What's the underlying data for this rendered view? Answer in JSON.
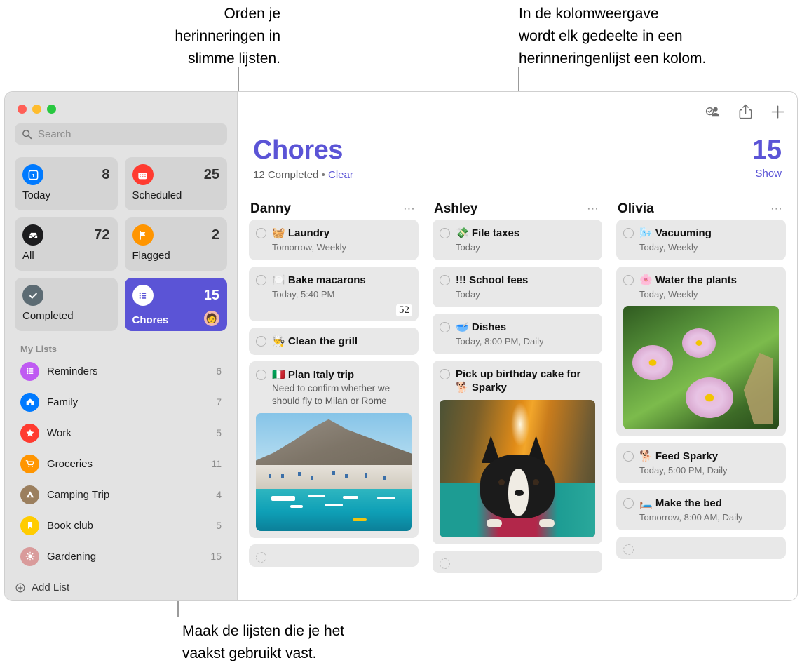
{
  "callouts": {
    "top_left": "Orden je\nherinneringen in\nslimme lijsten.",
    "top_right": "In de kolomweergave\nwordt elk gedeelte in een\nherinneringenlijst een kolom.",
    "bottom": "Maak de lijsten die je het\nvaakst gebruikt vast."
  },
  "colors": {
    "accent": "#5b54d6",
    "sidebar_bg": "#e3e3e3",
    "card_bg": "#e8e8e8"
  },
  "sidebar": {
    "search": {
      "placeholder": "Search"
    },
    "smart_lists": [
      {
        "label": "Today",
        "count": "8",
        "icon": "calendar-day-icon",
        "icon_bg": "#007aff",
        "active": false
      },
      {
        "label": "Scheduled",
        "count": "25",
        "icon": "calendar-icon",
        "icon_bg": "#ff3b30",
        "active": false
      },
      {
        "label": "All",
        "count": "72",
        "icon": "inbox-icon",
        "icon_bg": "#1c1c1e",
        "active": false
      },
      {
        "label": "Flagged",
        "count": "2",
        "icon": "flag-icon",
        "icon_bg": "#ff9500",
        "active": false
      },
      {
        "label": "Completed",
        "count": "",
        "icon": "checkmark-icon",
        "icon_bg": "#5c6b73",
        "active": false
      },
      {
        "label": "Chores",
        "count": "15",
        "icon": "list-bullet-icon",
        "icon_bg": "#ffffff",
        "active": true,
        "avatar": "avatar-icon"
      }
    ],
    "my_lists_header": "My Lists",
    "lists": [
      {
        "label": "Reminders",
        "count": "6",
        "icon": "list-bullet-icon",
        "icon_bg": "#bf5af2"
      },
      {
        "label": "Family",
        "count": "7",
        "icon": "house-icon",
        "icon_bg": "#007aff"
      },
      {
        "label": "Work",
        "count": "5",
        "icon": "star-icon",
        "icon_bg": "#ff3b30"
      },
      {
        "label": "Groceries",
        "count": "11",
        "icon": "cart-icon",
        "icon_bg": "#ff9500"
      },
      {
        "label": "Camping Trip",
        "count": "4",
        "icon": "tent-icon",
        "icon_bg": "#9b7f5e"
      },
      {
        "label": "Book club",
        "count": "5",
        "icon": "bookmark-icon",
        "icon_bg": "#ffcc00"
      },
      {
        "label": "Gardening",
        "count": "15",
        "icon": "sun-icon",
        "icon_bg": "#d99b9b"
      }
    ],
    "add_list_label": "Add List"
  },
  "main": {
    "toolbar": [
      {
        "name": "share-people-icon"
      },
      {
        "name": "share-icon"
      },
      {
        "name": "add-icon"
      }
    ],
    "title": "Chores",
    "completed_text": "12 Completed",
    "separator": "•",
    "clear_label": "Clear",
    "count": "15",
    "show_label": "Show",
    "columns": [
      {
        "title": "Danny",
        "more": "⋯",
        "items": [
          {
            "emoji": "🧺",
            "title": "Laundry",
            "sub": "Tomorrow, Weekly"
          },
          {
            "emoji": "🍽️",
            "title": "Bake macarons",
            "sub": "Today, 5:40 PM",
            "badge": "52"
          },
          {
            "emoji": "👨‍🍳",
            "title": "Clean the grill",
            "sub": ""
          },
          {
            "emoji": "🇮🇹",
            "title": "Plan Italy trip",
            "note": "Need to confirm whether we should fly to Milan or Rome",
            "photo": "italy"
          },
          {
            "empty": true
          }
        ]
      },
      {
        "title": "Ashley",
        "more": "⋯",
        "items": [
          {
            "emoji": "💸",
            "title": "File taxes",
            "sub": "Today"
          },
          {
            "emoji": "",
            "title": "!!! School fees",
            "sub": "Today"
          },
          {
            "emoji": "🥣",
            "title": "Dishes",
            "sub": "Today, 8:00 PM, Daily"
          },
          {
            "emoji": "",
            "title": "Pick up birthday cake for 🐕 Sparky",
            "photo": "dog"
          },
          {
            "empty": true
          }
        ]
      },
      {
        "title": "Olivia",
        "more": "⋯",
        "items": [
          {
            "emoji": "🌬️",
            "title": "Vacuuming",
            "sub": "Today, Weekly"
          },
          {
            "emoji": "🌸",
            "title": "Water the plants",
            "sub": "Today, Weekly",
            "photo": "flowers"
          },
          {
            "emoji": "🐕",
            "title": "Feed Sparky",
            "sub": "Today, 5:00 PM, Daily"
          },
          {
            "emoji": "🛏️",
            "title": "Make the bed",
            "sub": "Tomorrow, 8:00 AM, Daily"
          },
          {
            "empty": true
          }
        ]
      }
    ]
  }
}
